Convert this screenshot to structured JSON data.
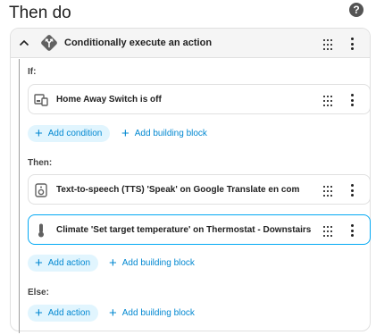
{
  "page": {
    "title": "Then do",
    "help_icon": "help-circle-icon",
    "help_glyph": "?"
  },
  "block": {
    "title": "Conditionally execute an action",
    "collapse_icon": "chevron-up-icon",
    "type_icon": "source-branch-icon"
  },
  "if_section": {
    "label": "If:",
    "items": [
      {
        "label": "Home Away Switch is off",
        "icon": "device-state-icon"
      }
    ],
    "add_condition_label": "Add condition",
    "add_block_label": "Add building block"
  },
  "then_section": {
    "label": "Then:",
    "items": [
      {
        "label": "Text-to-speech (TTS) 'Speak' on Google Translate en com",
        "icon": "speaker-icon",
        "selected": false
      },
      {
        "label": "Climate 'Set target temperature' on Thermostat - Downstairs",
        "icon": "thermometer-icon",
        "selected": true
      }
    ],
    "add_action_label": "Add action",
    "add_block_label": "Add building block"
  },
  "else_section": {
    "label": "Else:",
    "add_action_label": "Add action",
    "add_block_label": "Add building block"
  },
  "colors": {
    "accent": "#03a9f4",
    "accent_text": "#0288d1",
    "chip_bg": "#e1f5fe",
    "header_bg": "#f5f5f5",
    "border": "#e0e0e0",
    "diamond": "#616161"
  }
}
